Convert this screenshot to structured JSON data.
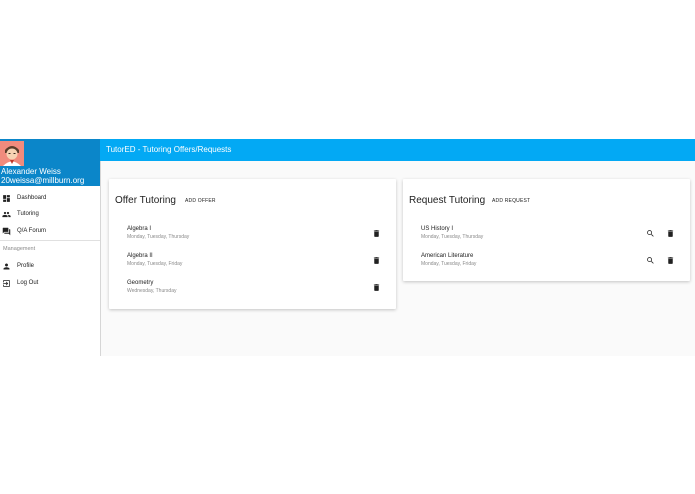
{
  "sidebar": {
    "user_name": "Alexander Weiss",
    "user_email": "20weissa@millburn.org",
    "nav": [
      {
        "label": "Dashboard",
        "icon": "dashboard-icon"
      },
      {
        "label": "Tutoring",
        "icon": "people-icon"
      },
      {
        "label": "Q/A Forum",
        "icon": "forum-icon"
      }
    ],
    "management_label": "Management",
    "management": [
      {
        "label": "Profile",
        "icon": "person-icon"
      },
      {
        "label": "Log Out",
        "icon": "logout-icon"
      }
    ]
  },
  "toolbar": {
    "title": "TutorED - Tutoring Offers/Requests"
  },
  "offer_card": {
    "title": "Offer Tutoring",
    "action": "ADD OFFER",
    "items": [
      {
        "subject": "Algebra I",
        "days": "Monday, Tuesday, Thursday"
      },
      {
        "subject": "Algebra II",
        "days": "Monday, Tuesday, Friday"
      },
      {
        "subject": "Geometry",
        "days": "Wednesday, Thursday"
      }
    ]
  },
  "request_card": {
    "title": "Request Tutoring",
    "action": "ADD REQUEST",
    "items": [
      {
        "subject": "US History I",
        "days": "Monday, Tuesday, Thursday"
      },
      {
        "subject": "American Literature",
        "days": "Monday, Tuesday, Friday"
      }
    ]
  },
  "colors": {
    "sidebar_header": "#0b86c9",
    "toolbar": "#03a9f4",
    "background": "#fafafa"
  },
  "icons": {
    "delete": "trash-icon",
    "view": "search-icon",
    "avatar": "avatar"
  }
}
